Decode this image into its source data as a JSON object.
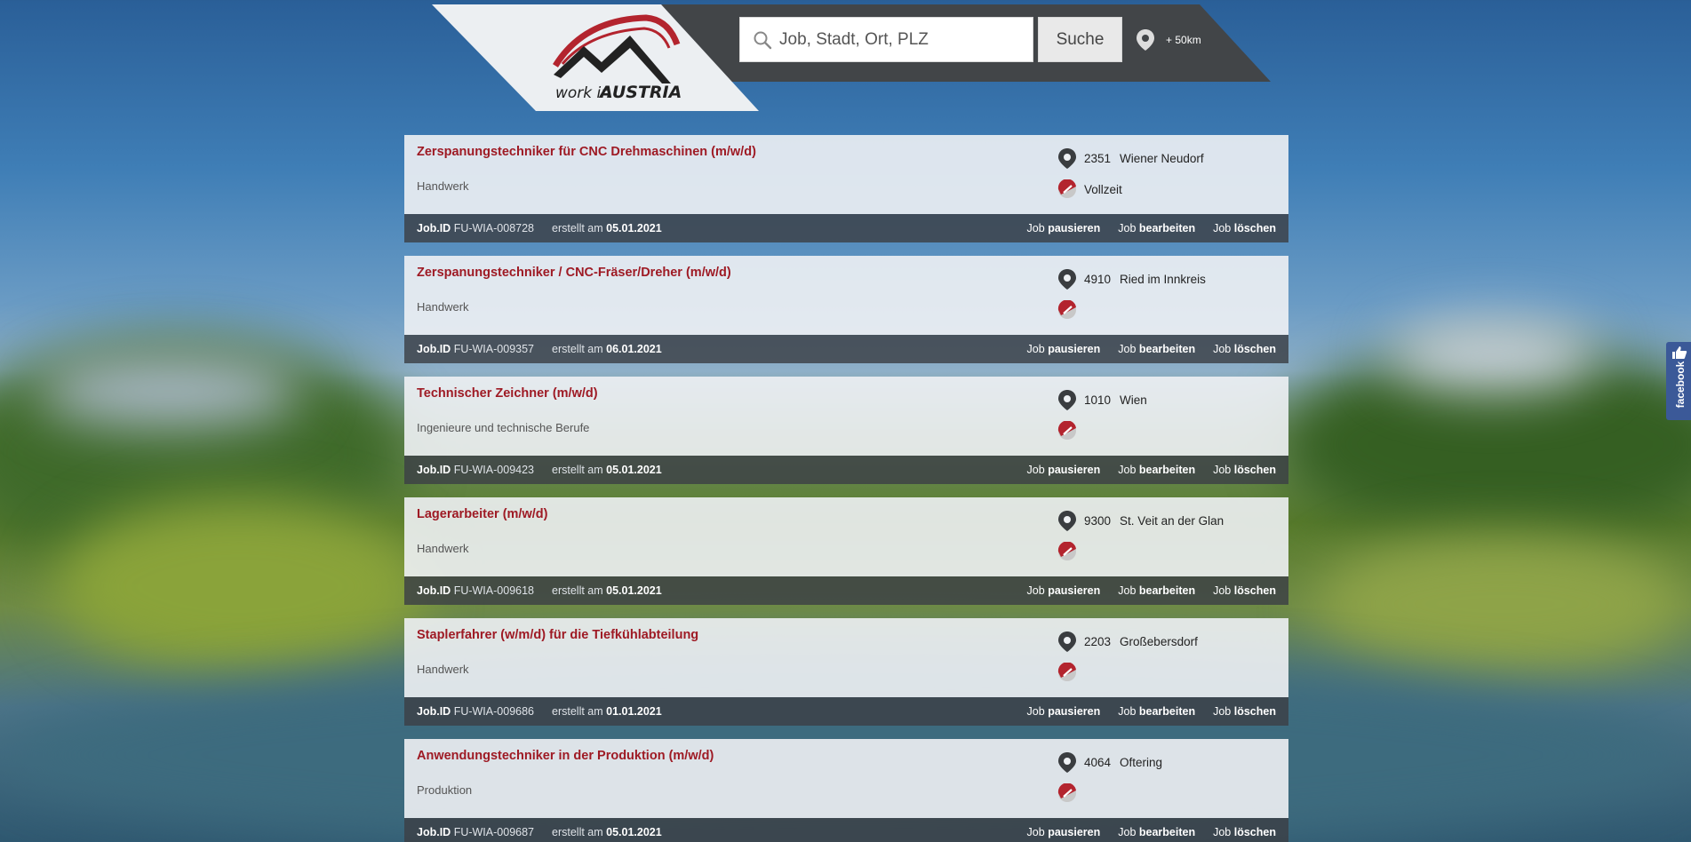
{
  "header": {
    "logo_text_1": "work in",
    "logo_text_2": "AUSTRIA",
    "search_placeholder": "Job, Stadt, Ort, PLZ",
    "search_button": "Suche",
    "radius_label": "+ 50km"
  },
  "jobs": [
    {
      "title": "Zerspanungstechniker für CNC Drehmaschinen (m/w/d)",
      "category": "Handwerk",
      "plz": "2351",
      "city": "Wiener Neudorf",
      "type": "Vollzeit",
      "id_label": "Job.ID",
      "id": "FU-WIA-008728",
      "created_label": "erstellt am",
      "date": "05.01.2021",
      "job_word": "Job",
      "pause": "pausieren",
      "edit": "bearbeiten",
      "delete": "löschen"
    },
    {
      "title": "Zerspanungstechniker / CNC-Fräser/Dreher (m/w/d)",
      "category": "Handwerk",
      "plz": "4910",
      "city": "Ried im Innkreis",
      "type": "",
      "id_label": "Job.ID",
      "id": "FU-WIA-009357",
      "created_label": "erstellt am",
      "date": "06.01.2021",
      "job_word": "Job",
      "pause": "pausieren",
      "edit": "bearbeiten",
      "delete": "löschen"
    },
    {
      "title": "Technischer Zeichner (m/w/d)",
      "category": "Ingenieure und technische Berufe",
      "plz": "1010",
      "city": "Wien",
      "type": "",
      "id_label": "Job.ID",
      "id": "FU-WIA-009423",
      "created_label": "erstellt am",
      "date": "05.01.2021",
      "job_word": "Job",
      "pause": "pausieren",
      "edit": "bearbeiten",
      "delete": "löschen"
    },
    {
      "title": "Lagerarbeiter (m/w/d)",
      "category": "Handwerk",
      "plz": "9300",
      "city": "St. Veit an der Glan",
      "type": "",
      "id_label": "Job.ID",
      "id": "FU-WIA-009618",
      "created_label": "erstellt am",
      "date": "05.01.2021",
      "job_word": "Job",
      "pause": "pausieren",
      "edit": "bearbeiten",
      "delete": "löschen"
    },
    {
      "title": "Staplerfahrer (w/m/d) für die Tiefkühlabteilung",
      "category": "Handwerk",
      "plz": "2203",
      "city": "Großebersdorf",
      "type": "",
      "id_label": "Job.ID",
      "id": "FU-WIA-009686",
      "created_label": "erstellt am",
      "date": "01.01.2021",
      "job_word": "Job",
      "pause": "pausieren",
      "edit": "bearbeiten",
      "delete": "löschen"
    },
    {
      "title": "Anwendungstechniker in der Produktion (m/w/d)",
      "category": "Produktion",
      "plz": "4064",
      "city": "Oftering",
      "type": "",
      "id_label": "Job.ID",
      "id": "FU-WIA-009687",
      "created_label": "erstellt am",
      "date": "05.01.2021",
      "job_word": "Job",
      "pause": "pausieren",
      "edit": "bearbeiten",
      "delete": "löschen"
    }
  ],
  "facebook_tab": {
    "label": "facebook"
  },
  "colors": {
    "accent": "#9e1a24",
    "dark_bar": "#424548",
    "facebook": "#3b5998"
  },
  "icons": {
    "search": "magnifier-icon",
    "location": "map-pin-icon",
    "jobtype": "jobtype-badge-icon",
    "like": "thumbs-up-icon"
  }
}
